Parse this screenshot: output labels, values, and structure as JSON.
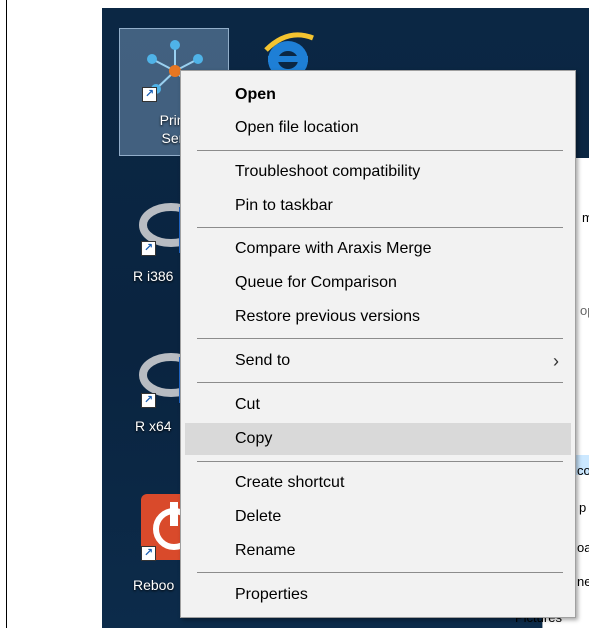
{
  "desktop": {
    "icons": [
      {
        "label_line1": "Prim",
        "label_line2": "Sen"
      },
      {
        "label": "R i386"
      },
      {
        "label": "R x64"
      },
      {
        "label": "Reboo"
      }
    ],
    "shortcut_glyph": "↗"
  },
  "explorer_fragments": [
    "m",
    "op",
    "co",
    "p",
    "oa",
    "ne",
    "Pictures"
  ],
  "context_menu": {
    "items": [
      {
        "label": "Open",
        "bold": true
      },
      {
        "label": "Open file location"
      },
      {
        "label": "Troubleshoot compatibility"
      },
      {
        "label": "Pin to taskbar"
      },
      {
        "label": "Compare with Araxis Merge"
      },
      {
        "label": "Queue for Comparison"
      },
      {
        "label": "Restore previous versions"
      },
      {
        "label": "Send to",
        "submenu": true
      },
      {
        "label": "Cut"
      },
      {
        "label": "Copy",
        "highlighted": true
      },
      {
        "label": "Create shortcut"
      },
      {
        "label": "Delete"
      },
      {
        "label": "Rename"
      },
      {
        "label": "Properties"
      }
    ],
    "submenu_glyph": "›"
  }
}
